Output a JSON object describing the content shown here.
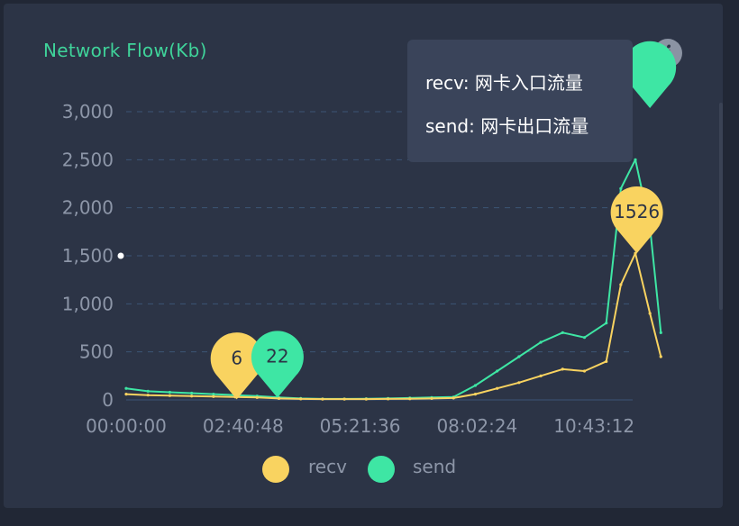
{
  "title": "Network Flow(Kb)",
  "info_icon": "info-icon",
  "tooltip": {
    "recv": "recv: 网卡入口流量",
    "send": "send: 网卡出口流量"
  },
  "legend": [
    {
      "name": "recv",
      "color": "#f9d360"
    },
    {
      "name": "send",
      "color": "#3ee6a4"
    }
  ],
  "markers": [
    {
      "series": "recv",
      "label": "6",
      "x": "02:32:00",
      "y": 6
    },
    {
      "series": "send",
      "label": "22",
      "x": "03:28:00",
      "y": 22
    },
    {
      "series": "recv",
      "label": "1526",
      "x": "11:42:00",
      "y": 1526
    },
    {
      "series": "send",
      "label": "",
      "x": "12:00:00",
      "y": 3200
    }
  ],
  "chart_data": {
    "type": "line",
    "title": "Network Flow(Kb)",
    "xlabel": "",
    "ylabel": "",
    "ylim": [
      0,
      3000
    ],
    "y_ticks": [
      "0",
      "500",
      "1,000",
      "1,500",
      "2,000",
      "2,500",
      "3,000"
    ],
    "x_ticks": [
      "00:00:00",
      "02:40:48",
      "05:21:36",
      "08:02:24",
      "10:43:12"
    ],
    "grid": true,
    "legend_position": "bottom",
    "x": [
      "00:00",
      "00:30",
      "01:00",
      "01:30",
      "02:00",
      "02:30",
      "03:00",
      "03:30",
      "04:00",
      "04:30",
      "05:00",
      "05:30",
      "06:00",
      "06:30",
      "07:00",
      "07:30",
      "08:00",
      "08:30",
      "09:00",
      "09:30",
      "10:00",
      "10:30",
      "11:00",
      "11:20",
      "11:40",
      "12:00",
      "12:15"
    ],
    "series": [
      {
        "name": "recv",
        "values": [
          60,
          50,
          45,
          40,
          35,
          30,
          25,
          15,
          10,
          8,
          8,
          8,
          10,
          12,
          15,
          20,
          60,
          120,
          180,
          250,
          320,
          300,
          400,
          1200,
          1526,
          900,
          450
        ]
      },
      {
        "name": "send",
        "values": [
          120,
          90,
          80,
          70,
          60,
          50,
          40,
          25,
          15,
          10,
          10,
          12,
          15,
          20,
          25,
          30,
          150,
          300,
          450,
          600,
          700,
          650,
          800,
          2200,
          2500,
          1800,
          700
        ]
      }
    ]
  }
}
